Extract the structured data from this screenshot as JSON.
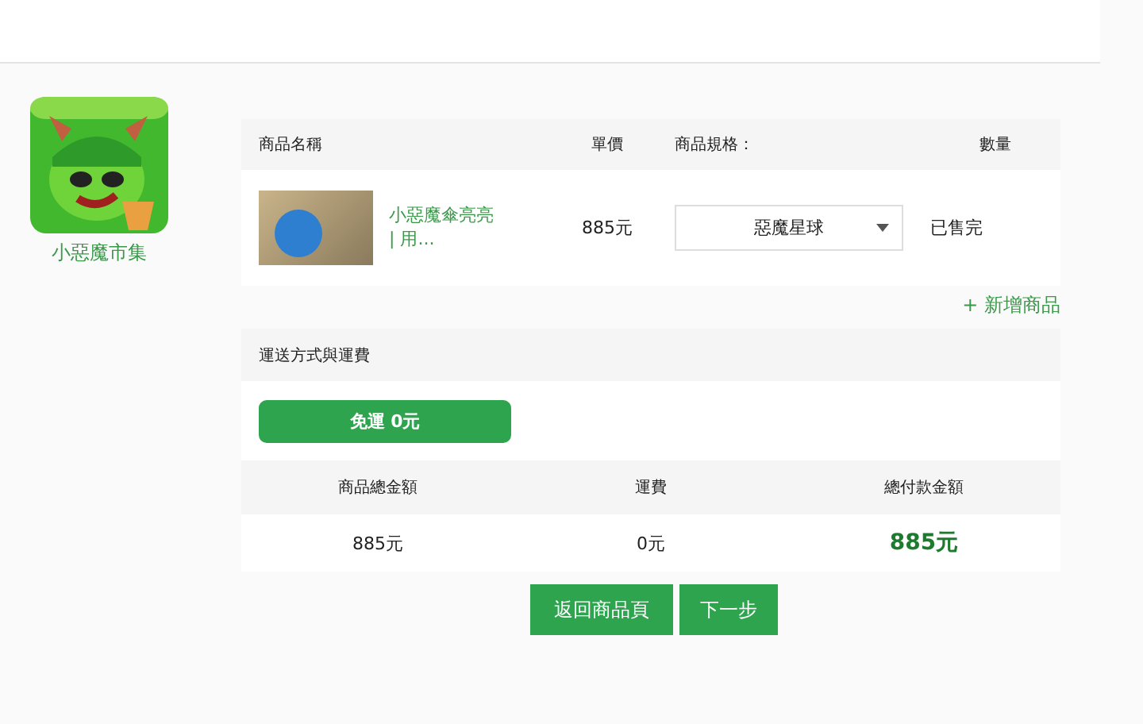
{
  "store": {
    "name": "小惡魔市集"
  },
  "cart": {
    "columns": [
      "商品名稱",
      "單價",
      "商品規格：",
      "數量"
    ],
    "items": [
      {
        "name": "小惡魔傘亮亮 | 用...",
        "price": "885元",
        "spec": "惡魔星球",
        "quantity": "已售完"
      }
    ],
    "add_link": "+ 新增商品"
  },
  "shipping": {
    "title": "運送方式與運費",
    "options": [
      {
        "label": "免運 0元",
        "selected": true
      }
    ]
  },
  "summary": {
    "columns": [
      "商品總金額",
      "運費",
      "總付款金額"
    ],
    "values": [
      "885元",
      "0元",
      "885元"
    ]
  },
  "buttons": [
    "返回商品頁",
    "下一步"
  ]
}
